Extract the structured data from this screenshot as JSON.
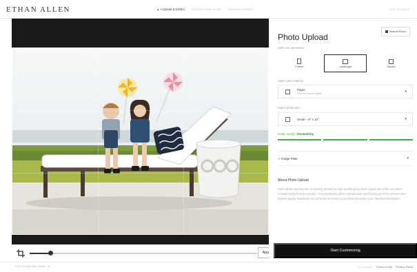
{
  "header": {
    "brand": "ETHAN ALLEN",
    "steps": [
      {
        "label": "• Upload & Edit(s)",
        "active": true
      },
      {
        "label": "Choose Frame & Mat",
        "active": false
      },
      {
        "label": "Review & Preview",
        "active": false
      }
    ],
    "right_text": "Save Progress"
  },
  "editor": {
    "zoom_fraction": 0.09,
    "apply_label": "Apply"
  },
  "panel": {
    "title": "Photo Upload",
    "manual_crop_label": "Manual Photo",
    "orientation_label": "Select an orientation",
    "orientations": [
      {
        "label": "Portrait",
        "selected": false
      },
      {
        "label": "Landscape",
        "selected": true
      },
      {
        "label": "Square",
        "selected": false
      }
    ],
    "material_label": "Select your material",
    "material_value": "Paper",
    "material_sub": "Fine art archival paper",
    "size_label": "Select photo size",
    "size_value": "Small – 8\" x 10\"",
    "quality_label": "Image quality: ",
    "quality_value": "Outstanding",
    "quality_segments": 3,
    "filters_label": "Image Filter",
    "about_title": "About Photo Upload",
    "about_body": "Each photo reproduction is expertly printed on high-quality gloss photo paper and is fine art water-resistant (polychrome canvas). Our proprietary photo reproduction and framing process ensures that highest quality standards are achieved to ensure your photo becomes your cherished keepsake.",
    "start_label": "Start Customizing"
  },
  "footer": {
    "copyright": "©2021 Ethan Allen Global, Inc.",
    "links": [
      "Terms of Use",
      "Privacy Policy"
    ],
    "faint_text": "Accessibility"
  },
  "colors": {
    "quality_green": "#3fae49",
    "accent_dark": "#111111"
  }
}
